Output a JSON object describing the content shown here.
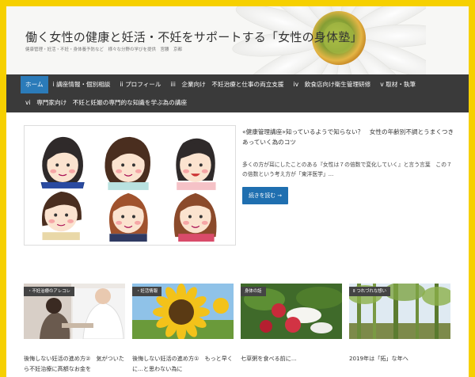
{
  "header": {
    "title": "働く女性の健康と妊活・不妊をサポートする「女性の身体塾」",
    "description": "健康管理・妊活・不妊・身体養予防など　様々な分野の学びを提供　宮腰　京都"
  },
  "nav": {
    "row1": [
      {
        "label": "ホーム"
      },
      {
        "label": "i 講座情報・個別相談"
      },
      {
        "label": "ii プロフィール"
      },
      {
        "label": "iii　企業向け　不妊治療と仕事の両立支援"
      },
      {
        "label": "iv　飲食店向け衛生管理研修"
      },
      {
        "label": "v 取材・執筆"
      }
    ],
    "row2": [
      {
        "label": "vi　専門家向け　不妊と妊娠の専門的な知識を学ぶ為の講座"
      }
    ]
  },
  "featured": {
    "title": "«健康管理講座»知っているようで知らない？　女性の年齢別不調とうまくつきあっていく為のコツ",
    "excerpt": "多くの方が耳にしたことのある『女性は７の倍数で変化していく』と言う言葉　この７の倍数という考え方が「東洋医学」...",
    "read_more": "続きを読む →",
    "image_icon": "six-women-illustration"
  },
  "posts": [
    {
      "badge": "・不妊治療のアレコレ",
      "title": "後悔しない妊活の進め方②　気がついたら不妊治療に高額なお金を",
      "image_icon": "doctor-consultation-photo"
    },
    {
      "badge": "・妊活情報",
      "title": "後悔しない妊活の進め方①　もっと早くに...と思わない為に",
      "image_icon": "sunflower-photo"
    },
    {
      "badge": "身体の話",
      "title": "七草粥を食べる前に...",
      "image_icon": "radish-vegetables-photo"
    },
    {
      "badge": "Ⅱ つれづれな想い",
      "title": "2019年は「拓」な年へ",
      "image_icon": "bamboo-forest-photo"
    }
  ],
  "colors": {
    "frame": "#f6d000",
    "nav_bg": "#3a3a3a",
    "nav_active": "#2b7bb9",
    "button": "#1f6fb0"
  }
}
